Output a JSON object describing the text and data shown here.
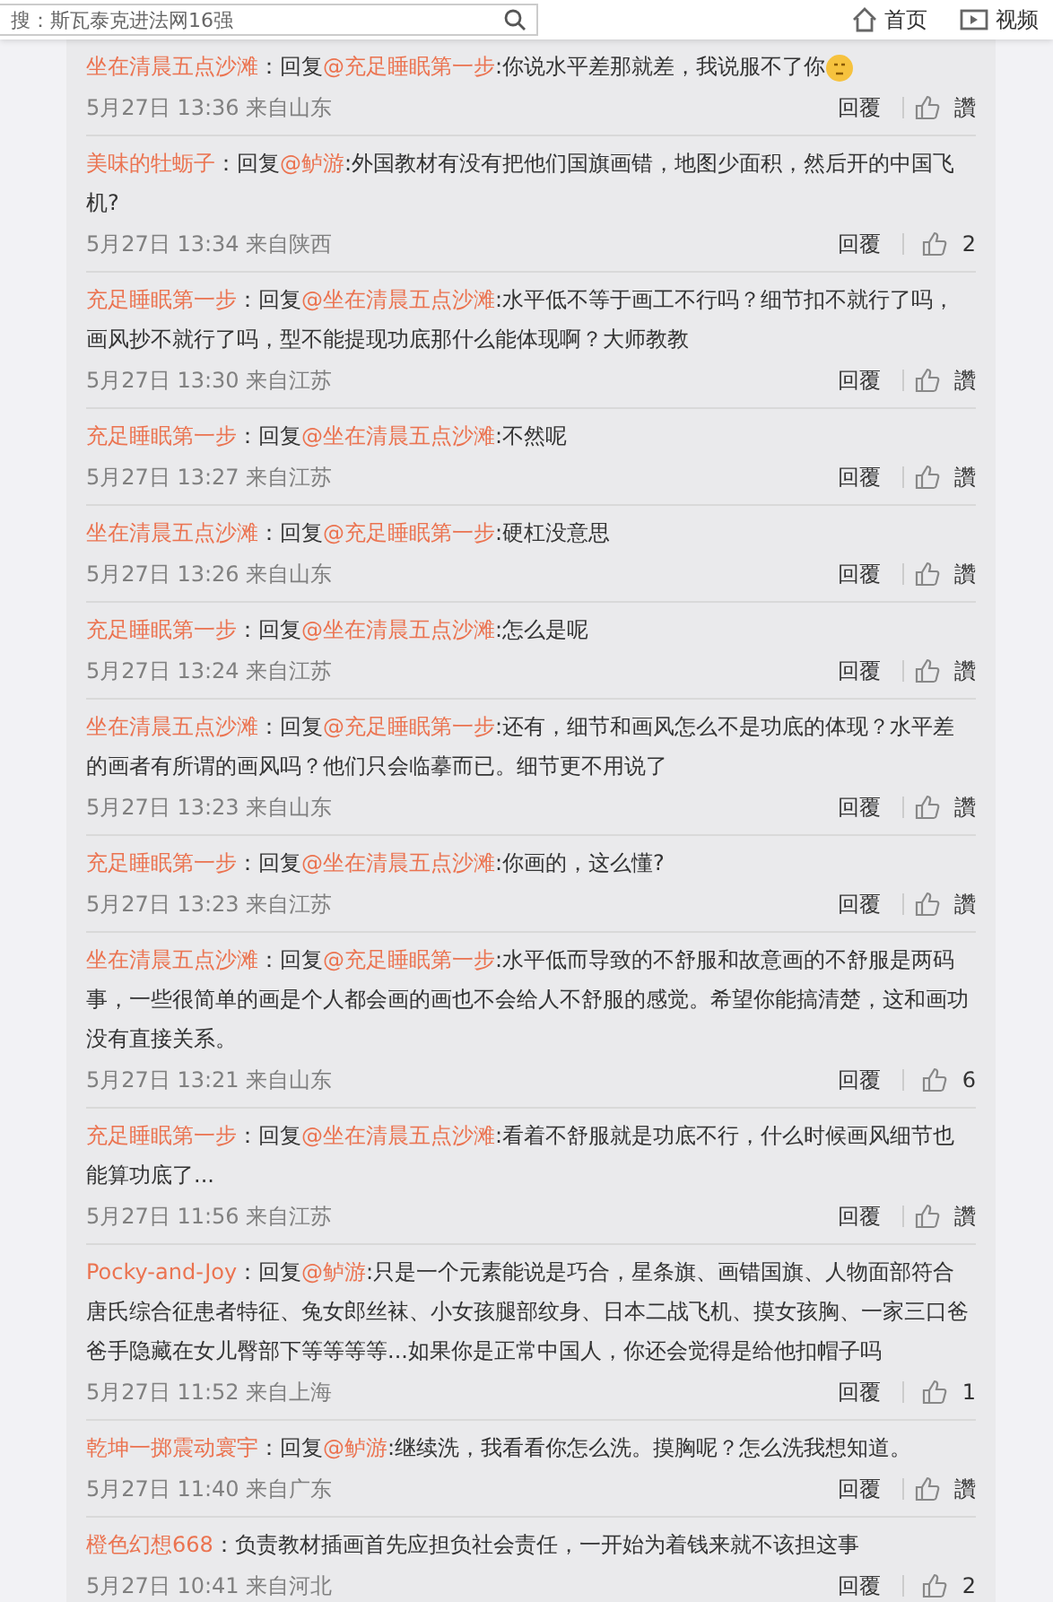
{
  "header": {
    "search": {
      "value": "搜：斯瓦泰克进法网16强"
    },
    "nav": [
      {
        "kind": "home",
        "label": "首页"
      },
      {
        "kind": "video",
        "label": "视频"
      }
    ]
  },
  "comments": [
    {
      "segments": [
        {
          "kind": "user",
          "text": "坐在清晨五点沙滩"
        },
        {
          "kind": "plain",
          "text": "：回复"
        },
        {
          "kind": "mention",
          "text": "@充足睡眠第一步"
        },
        {
          "kind": "plain",
          "text": ":你说水平差那就差，我说服不了你"
        },
        {
          "kind": "emoji"
        }
      ],
      "meta": "5月27日 13:36 来自山东",
      "reply": "回覆",
      "likes": "讚"
    },
    {
      "segments": [
        {
          "kind": "user",
          "text": "美味的牡蛎子"
        },
        {
          "kind": "plain",
          "text": "：回复"
        },
        {
          "kind": "mention",
          "text": "@鲈游"
        },
        {
          "kind": "plain",
          "text": ":外国教材有没有把他们国旗画错，地图少面积，然后开的中国飞机?"
        }
      ],
      "meta": "5月27日 13:34 来自陕西",
      "reply": "回覆",
      "likes": "2"
    },
    {
      "segments": [
        {
          "kind": "user",
          "text": "充足睡眠第一步"
        },
        {
          "kind": "plain",
          "text": "：回复"
        },
        {
          "kind": "mention",
          "text": "@坐在清晨五点沙滩"
        },
        {
          "kind": "plain",
          "text": ":水平低不等于画工不行吗？细节扣不就行了吗，画风抄不就行了吗，型不能提现功底那什么能体现啊？大师教教"
        }
      ],
      "meta": "5月27日 13:30 来自江苏",
      "reply": "回覆",
      "likes": "讚"
    },
    {
      "segments": [
        {
          "kind": "user",
          "text": "充足睡眠第一步"
        },
        {
          "kind": "plain",
          "text": "：回复"
        },
        {
          "kind": "mention",
          "text": "@坐在清晨五点沙滩"
        },
        {
          "kind": "plain",
          "text": ":不然呢"
        }
      ],
      "meta": "5月27日 13:27 来自江苏",
      "reply": "回覆",
      "likes": "讚"
    },
    {
      "segments": [
        {
          "kind": "user",
          "text": "坐在清晨五点沙滩"
        },
        {
          "kind": "plain",
          "text": "：回复"
        },
        {
          "kind": "mention",
          "text": "@充足睡眠第一步"
        },
        {
          "kind": "plain",
          "text": ":硬杠没意思"
        }
      ],
      "meta": "5月27日 13:26 来自山东",
      "reply": "回覆",
      "likes": "讚"
    },
    {
      "segments": [
        {
          "kind": "user",
          "text": "充足睡眠第一步"
        },
        {
          "kind": "plain",
          "text": "：回复"
        },
        {
          "kind": "mention",
          "text": "@坐在清晨五点沙滩"
        },
        {
          "kind": "plain",
          "text": ":怎么是呢"
        }
      ],
      "meta": "5月27日 13:24 来自江苏",
      "reply": "回覆",
      "likes": "讚"
    },
    {
      "segments": [
        {
          "kind": "user",
          "text": "坐在清晨五点沙滩"
        },
        {
          "kind": "plain",
          "text": "：回复"
        },
        {
          "kind": "mention",
          "text": "@充足睡眠第一步"
        },
        {
          "kind": "plain",
          "text": ":还有，细节和画风怎么不是功底的体现？水平差的画者有所谓的画风吗？他们只会临摹而已。细节更不用说了"
        }
      ],
      "meta": "5月27日 13:23 来自山东",
      "reply": "回覆",
      "likes": "讚"
    },
    {
      "segments": [
        {
          "kind": "user",
          "text": "充足睡眠第一步"
        },
        {
          "kind": "plain",
          "text": "：回复"
        },
        {
          "kind": "mention",
          "text": "@坐在清晨五点沙滩"
        },
        {
          "kind": "plain",
          "text": ":你画的，这么懂?"
        }
      ],
      "meta": "5月27日 13:23 来自江苏",
      "reply": "回覆",
      "likes": "讚"
    },
    {
      "segments": [
        {
          "kind": "user",
          "text": "坐在清晨五点沙滩"
        },
        {
          "kind": "plain",
          "text": "：回复"
        },
        {
          "kind": "mention",
          "text": "@充足睡眠第一步"
        },
        {
          "kind": "plain",
          "text": ":水平低而导致的不舒服和故意画的不舒服是两码事，一些很简单的画是个人都会画的画也不会给人不舒服的感觉。希望你能搞清楚，这和画功没有直接关系。"
        }
      ],
      "meta": "5月27日 13:21 来自山东",
      "reply": "回覆",
      "likes": "6"
    },
    {
      "segments": [
        {
          "kind": "user",
          "text": "充足睡眠第一步"
        },
        {
          "kind": "plain",
          "text": "：回复"
        },
        {
          "kind": "mention",
          "text": "@坐在清晨五点沙滩"
        },
        {
          "kind": "plain",
          "text": ":看着不舒服就是功底不行，什么时候画风细节也能算功底了..."
        }
      ],
      "meta": "5月27日 11:56 来自江苏",
      "reply": "回覆",
      "likes": "讚"
    },
    {
      "segments": [
        {
          "kind": "user",
          "text": "Pocky-and-Joy"
        },
        {
          "kind": "plain",
          "text": "：回复"
        },
        {
          "kind": "mention",
          "text": "@鲈游"
        },
        {
          "kind": "plain",
          "text": ":只是一个元素能说是巧合，星条旗、画错国旗、人物面部符合唐氏综合征患者特征、兔女郎丝袜、小女孩腿部纹身、日本二战飞机、摸女孩胸、一家三口爸爸手隐藏在女儿臀部下等等等等...如果你是正常中国人，你还会觉得是给他扣帽子吗"
        }
      ],
      "meta": "5月27日 11:52 来自上海",
      "reply": "回覆",
      "likes": "1"
    },
    {
      "segments": [
        {
          "kind": "user",
          "text": "乾坤一掷震动寰宇"
        },
        {
          "kind": "plain",
          "text": "：回复"
        },
        {
          "kind": "mention",
          "text": "@鲈游"
        },
        {
          "kind": "plain",
          "text": ":继续洗，我看看你怎么洗。摸胸呢？怎么洗我想知道。"
        }
      ],
      "meta": "5月27日 11:40 来自广东",
      "reply": "回覆",
      "likes": "讚"
    },
    {
      "segments": [
        {
          "kind": "user",
          "text": "橙色幻想668"
        },
        {
          "kind": "plain",
          "text": "：负责教材插画首先应担负社会责任，一开始为着钱来就不该担这事"
        }
      ],
      "meta": "5月27日 10:41 来自河北",
      "reply": "回覆",
      "likes": "2"
    }
  ]
}
